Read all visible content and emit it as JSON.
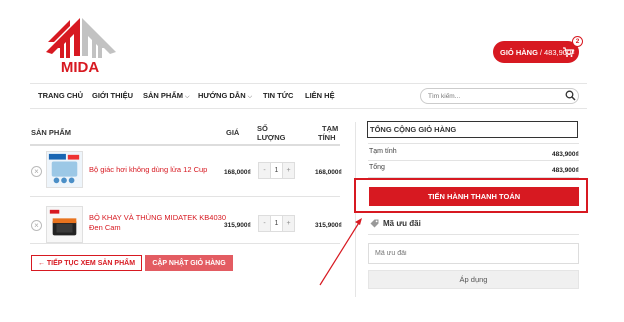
{
  "brand": {
    "name": "MIDA",
    "color": "#d71921"
  },
  "cart": {
    "label": "GIỎ HÀNG",
    "separator": "/",
    "amount": "483,900₫",
    "count": "2"
  },
  "nav": {
    "items": [
      {
        "label": "TRANG CHỦ",
        "dropdown": ""
      },
      {
        "label": "GIỚI THIỆU",
        "dropdown": ""
      },
      {
        "label": "SẢN PHẨM",
        "dropdown": "⌵"
      },
      {
        "label": "HƯỚNG DẪN",
        "dropdown": "⌵"
      },
      {
        "label": "TIN TỨC",
        "dropdown": ""
      },
      {
        "label": "LIÊN HỆ",
        "dropdown": ""
      }
    ],
    "search_placeholder": "Tìm kiếm..."
  },
  "table": {
    "headers": {
      "product": "SẢN PHẨM",
      "price": "GIÁ",
      "qty_1": "SỐ",
      "qty_2": "LƯỢNG",
      "total_1": "TẠM",
      "total_2": "TÍNH"
    },
    "rows": [
      {
        "remove": "×",
        "name_1": "Bộ giác hơi không dùng lửa 12 Cup",
        "name_2": "",
        "price": "168,000₫",
        "qty": "1",
        "minus": "-",
        "plus": "+",
        "subtotal": "168,000₫"
      },
      {
        "remove": "×",
        "name_1": "BỘ KHAY VÀ THÙNG MIDATEK KB4030",
        "name_2": "Đen Cam",
        "price": "315,900₫",
        "qty": "1",
        "minus": "-",
        "plus": "+",
        "subtotal": "315,900₫"
      }
    ],
    "continue_label": "← TIẾP TỤC XEM SẢN PHẨM",
    "update_label": "CẬP NHẬT GIỎ HÀNG"
  },
  "totals": {
    "title": "TỔNG CỘNG GIỎ HÀNG",
    "subtotal_label": "Tạm tính",
    "subtotal_value": "483,900₫",
    "total_label": "Tổng",
    "total_value": "483,900₫",
    "checkout_label": "TIẾN HÀNH THANH TOÁN",
    "coupon_title": "Mã ưu đãi",
    "coupon_placeholder": "Mã ưu đãi",
    "apply_label": "Áp dụng"
  },
  "icons": {
    "cart": "cart-icon",
    "search": "search-icon",
    "tag": "tag-icon",
    "remove": "close-icon",
    "annotation": "red-arrow"
  }
}
